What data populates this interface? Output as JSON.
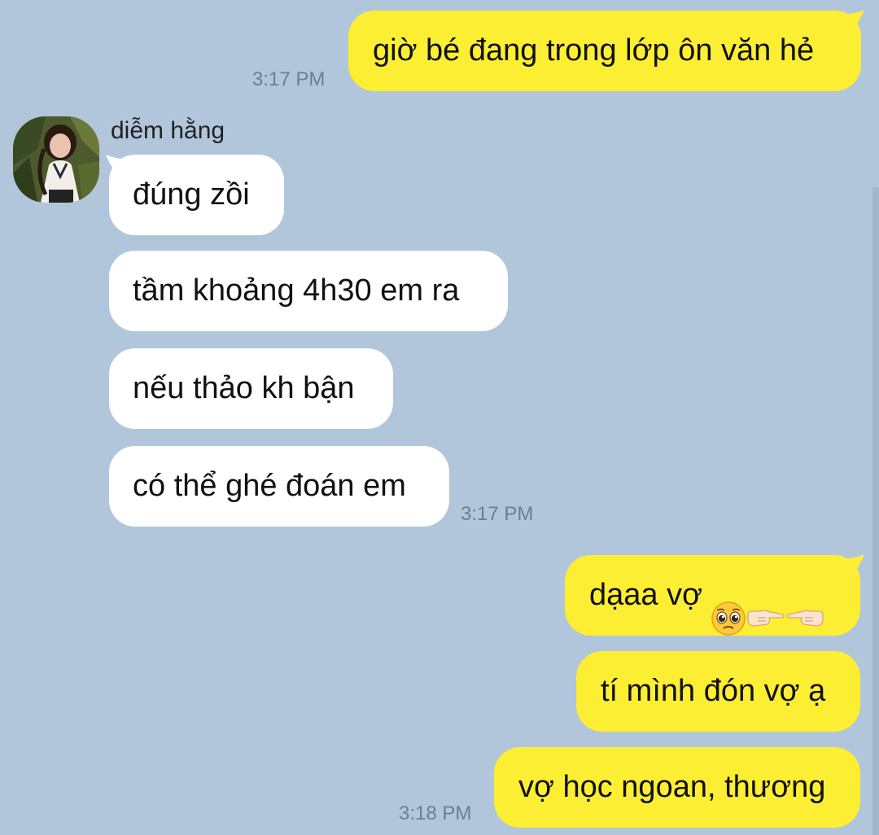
{
  "colors": {
    "background": "#B1C6DA",
    "outgoing_bubble": "#FCEE32",
    "incoming_bubble": "#FFFFFF",
    "timestamp_text": "#6E7E8E"
  },
  "contact": {
    "name": "diễm hằng",
    "avatar": "profile-photo"
  },
  "messages": [
    {
      "direction": "out",
      "text": "giờ bé đang trong lớp ôn văn hẻ",
      "time": "3:17 PM"
    },
    {
      "direction": "in",
      "text": "đúng zồi"
    },
    {
      "direction": "in",
      "text": "tầm khoảng 4h30 em ra"
    },
    {
      "direction": "in",
      "text": "nếu thảo kh bận"
    },
    {
      "direction": "in",
      "text": "có thể ghé đoán em",
      "time": "3:17 PM"
    },
    {
      "direction": "out",
      "text": "dạaa vợ",
      "emoji": [
        "pleading-face-icon",
        "right-pointing-hand-icon",
        "left-pointing-hand-icon"
      ]
    },
    {
      "direction": "out",
      "text": "tí mình đón vợ ạ"
    },
    {
      "direction": "out",
      "text": "vợ học ngoan, thương",
      "time": "3:18 PM"
    }
  ]
}
